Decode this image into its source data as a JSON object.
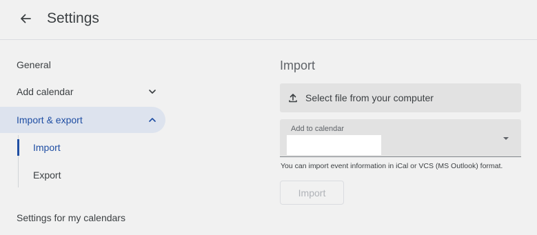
{
  "header": {
    "title": "Settings",
    "back_icon": "arrow-left-icon"
  },
  "sidebar": {
    "items": [
      {
        "label": "General"
      },
      {
        "label": "Add calendar",
        "icon": "chevron-down-icon"
      },
      {
        "label": "Import & export",
        "icon": "chevron-up-icon"
      }
    ],
    "sub_items": [
      {
        "label": "Import"
      },
      {
        "label": "Export"
      }
    ],
    "section_heading": "Settings for my calendars"
  },
  "import_panel": {
    "title": "Import",
    "file_button_label": "Select file from your computer",
    "file_button_icon": "upload-icon",
    "calendar_field_label": "Add to calendar",
    "calendar_dropdown_icon": "dropdown-arrow-icon",
    "hint": "You can import event information in iCal or VCS (MS Outlook) format.",
    "import_button_label": "Import"
  },
  "colors": {
    "accent": "#1f4ea3",
    "selected_bg": "#dde3ee",
    "background": "#f1f1f1",
    "field_bg": "#e2e2e2"
  }
}
